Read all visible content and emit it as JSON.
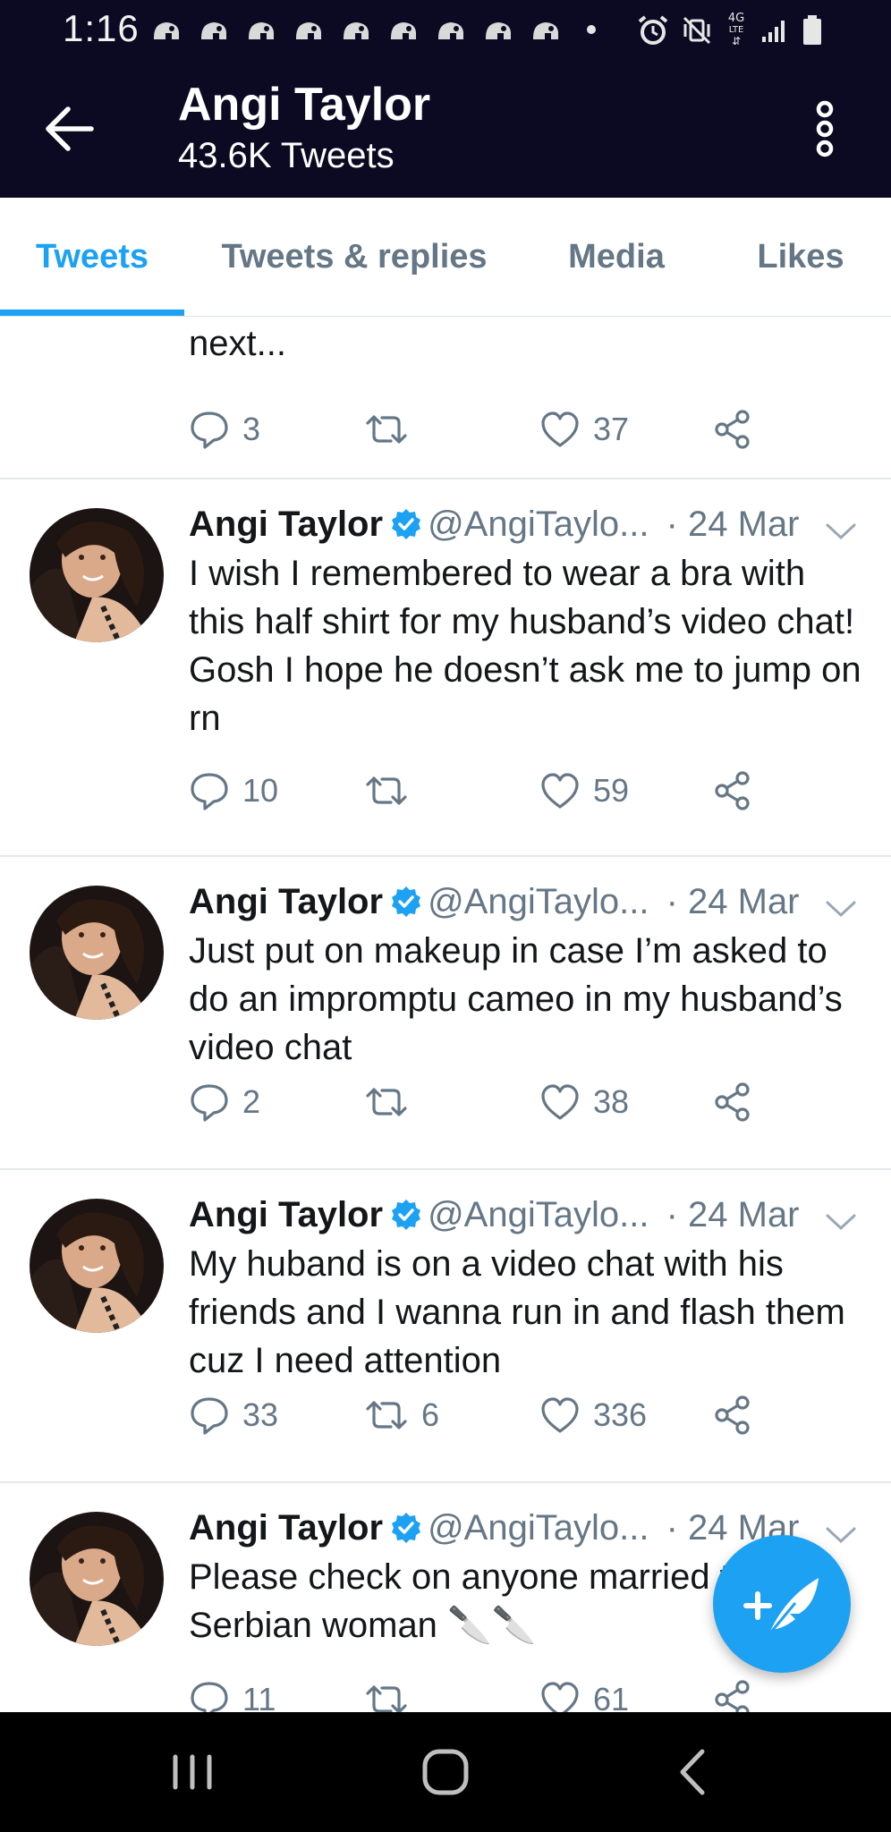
{
  "status_bar": {
    "time": "1:16",
    "notification_icons": [
      "app-notification-icon",
      "app-notification-icon",
      "app-notification-icon",
      "app-notification-icon",
      "app-notification-icon",
      "app-notification-icon",
      "app-notification-icon",
      "app-notification-icon",
      "app-notification-icon"
    ],
    "system_icons": [
      "alarm-icon",
      "mute-vibrate-icon",
      "network-4g-lte-icon",
      "signal-icon",
      "battery-icon"
    ],
    "network_label_top": "4G",
    "network_label_bottom": "LTE"
  },
  "header": {
    "name": "Angi Taylor",
    "tweet_count": "43.6K Tweets",
    "back_icon": "arrow-left-icon",
    "menu_icon": "more-vertical-icon"
  },
  "tabs": [
    {
      "label": "Tweets",
      "active": true
    },
    {
      "label": "Tweets & replies",
      "active": false
    },
    {
      "label": "Media",
      "active": false
    },
    {
      "label": "Likes",
      "active": false
    }
  ],
  "partial_tweet": {
    "text": "next...",
    "replies": "3",
    "retweets": "",
    "likes": "37"
  },
  "tweets": [
    {
      "name": "Angi Taylor",
      "handle": "@AngiTaylo...",
      "date": "· 24 Mar",
      "text": "I wish I remembered to wear a bra with this half shirt for my husband’s video chat! Gosh I hope he doesn’t ask me to jump on rn",
      "replies": "10",
      "retweets": "",
      "likes": "59"
    },
    {
      "name": "Angi Taylor",
      "handle": "@AngiTaylo...",
      "date": "· 24 Mar",
      "text": "Just put on makeup in case I’m asked to do an impromptu cameo in my husband’s video chat",
      "replies": "2",
      "retweets": "",
      "likes": "38"
    },
    {
      "name": "Angi Taylor",
      "handle": "@AngiTaylo...",
      "date": "· 24 Mar",
      "text": "My huband is on a video chat with his friends and I wanna run in and flash them cuz I need attention",
      "replies": "33",
      "retweets": "6",
      "likes": "336"
    },
    {
      "name": "Angi Taylor",
      "handle": "@AngiTaylo...",
      "date": "· 24 Mar",
      "text": "Please check on anyone married to a Serbian woman 🔪🔪",
      "replies": "11",
      "retweets": "",
      "likes": "61"
    }
  ],
  "colors": {
    "header_bg": "#0c0a22",
    "accent": "#1da1f2",
    "secondary_text": "#657786",
    "divider": "#e4e9ed"
  },
  "fab": {
    "icon": "compose-tweet-icon"
  },
  "nav_bar": {
    "icons": [
      "recent-apps-icon",
      "home-icon",
      "back-icon"
    ]
  }
}
